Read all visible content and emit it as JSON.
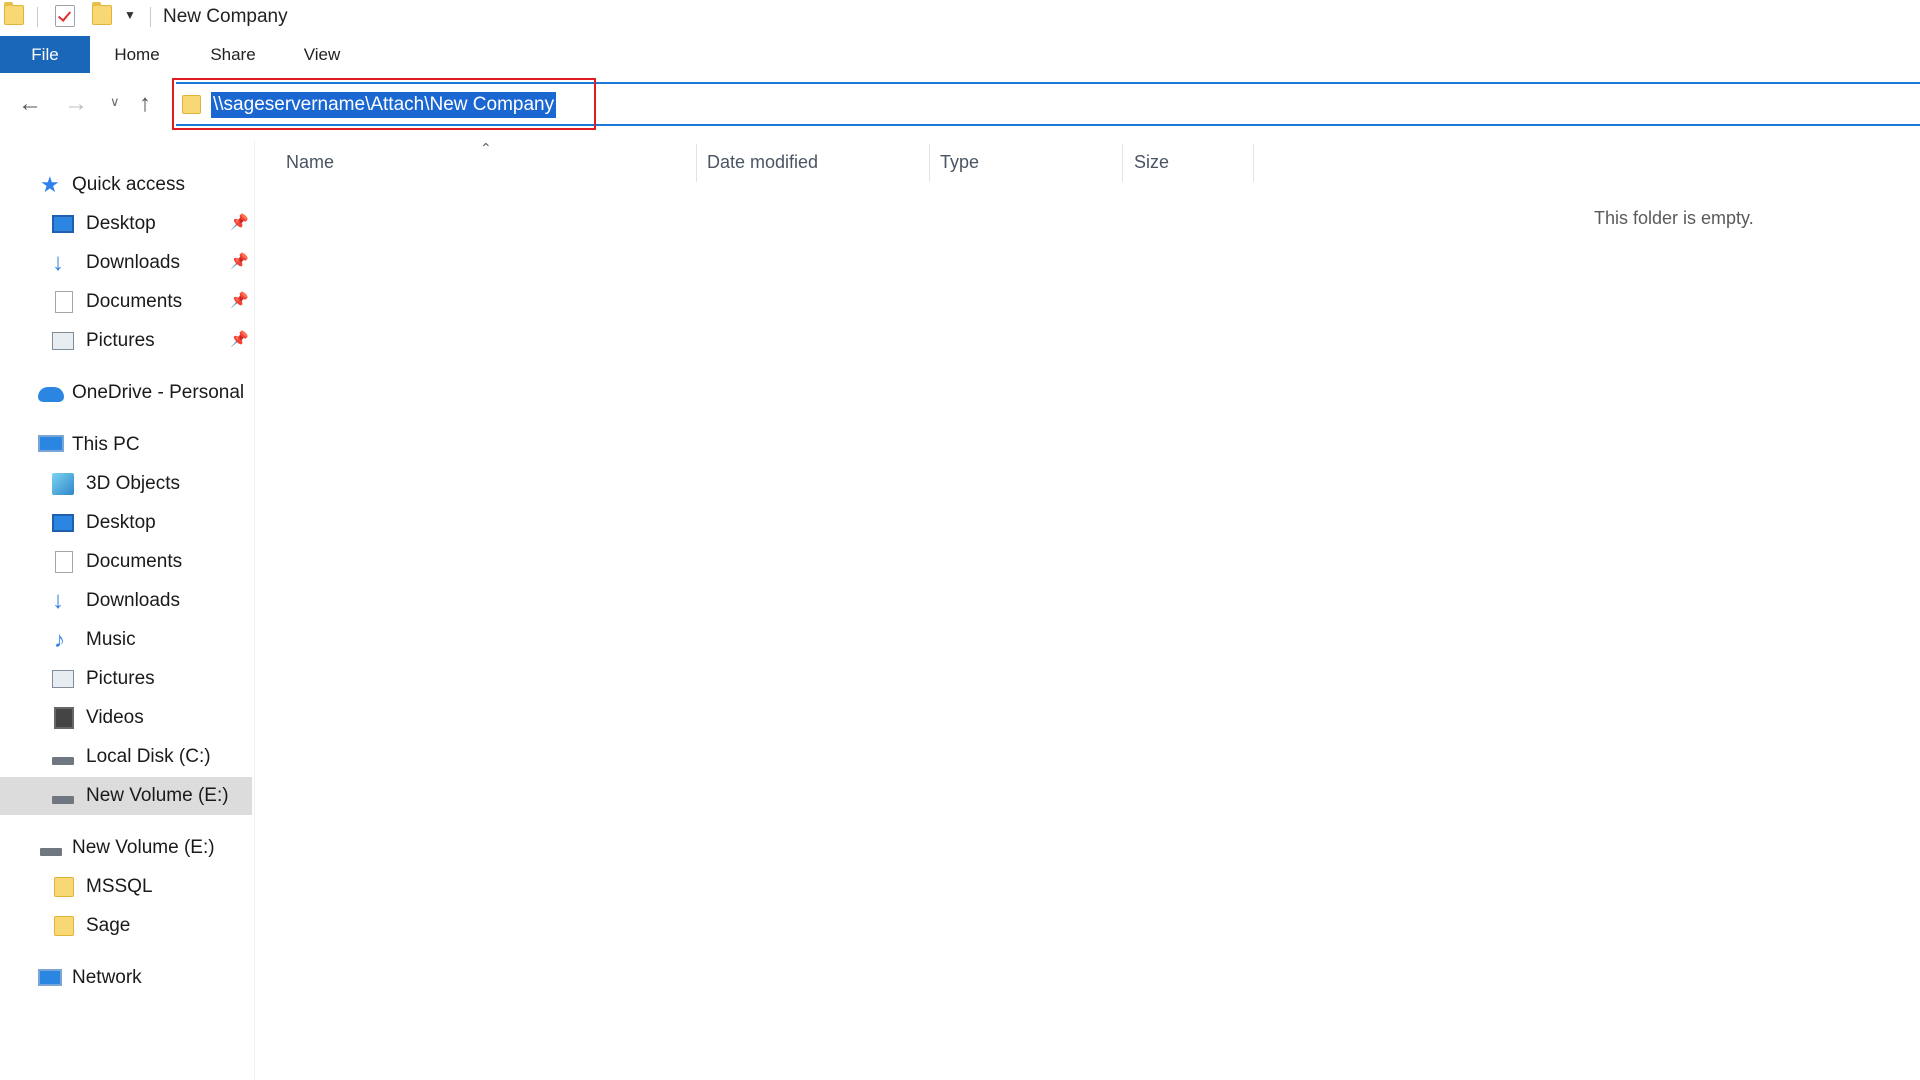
{
  "window": {
    "title": "New Company"
  },
  "ribbon": {
    "tabs": [
      {
        "label": "File"
      },
      {
        "label": "Home"
      },
      {
        "label": "Share"
      },
      {
        "label": "View"
      }
    ]
  },
  "address": {
    "path": "\\\\sageservername\\Attach\\New Company",
    "highlight_color": "#e21b23",
    "selection_color": "#1a67d1"
  },
  "sidebar": {
    "quick_access": {
      "label": "Quick access",
      "items": [
        {
          "label": "Desktop",
          "icon": "desktop-icon"
        },
        {
          "label": "Downloads",
          "icon": "downloads-icon"
        },
        {
          "label": "Documents",
          "icon": "documents-icon"
        },
        {
          "label": "Pictures",
          "icon": "pictures-icon"
        }
      ]
    },
    "onedrive": {
      "label": "OneDrive - Personal"
    },
    "this_pc": {
      "label": "This PC",
      "items": [
        {
          "label": "3D Objects"
        },
        {
          "label": "Desktop"
        },
        {
          "label": "Documents"
        },
        {
          "label": "Downloads"
        },
        {
          "label": "Music"
        },
        {
          "label": "Pictures"
        },
        {
          "label": "Videos"
        },
        {
          "label": "Local Disk (C:)"
        },
        {
          "label": "New Volume (E:)"
        }
      ]
    },
    "volume": {
      "label": "New Volume (E:)",
      "items": [
        {
          "label": "MSSQL"
        },
        {
          "label": "Sage"
        }
      ]
    },
    "network": {
      "label": "Network"
    }
  },
  "content": {
    "columns": [
      {
        "label": "Name"
      },
      {
        "label": "Date modified"
      },
      {
        "label": "Type"
      },
      {
        "label": "Size"
      }
    ],
    "empty_message": "This folder is empty."
  }
}
